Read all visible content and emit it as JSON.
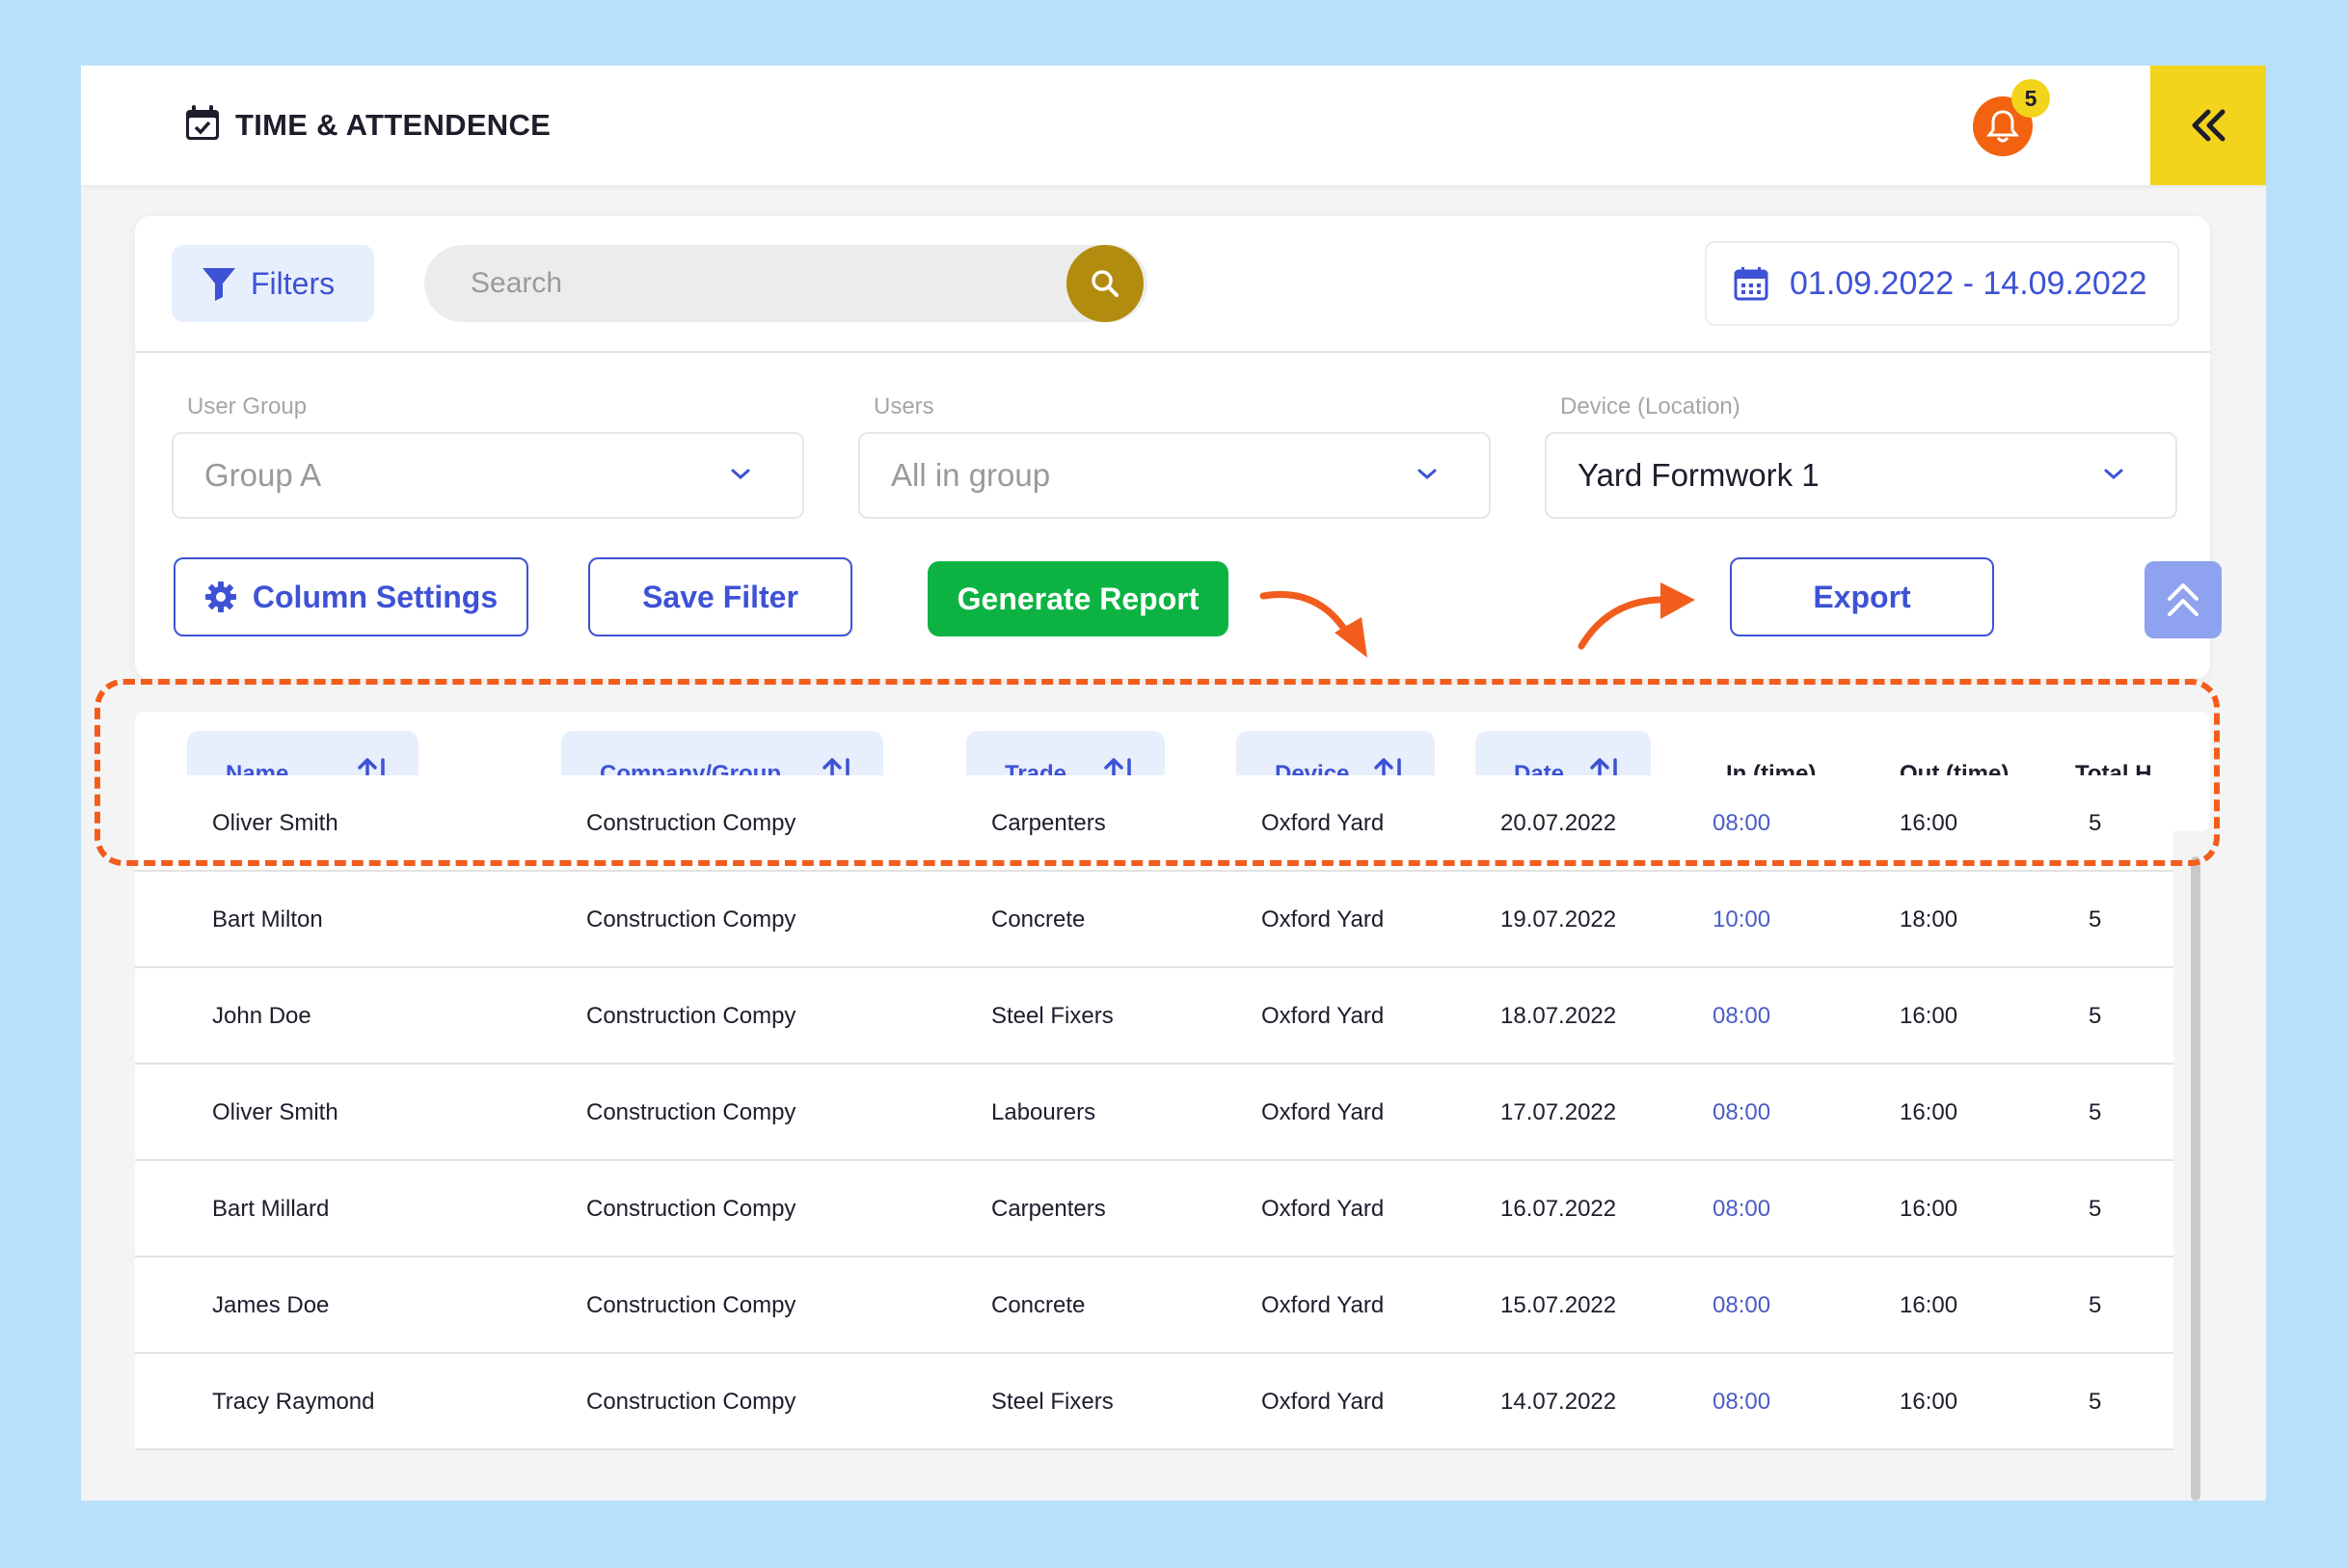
{
  "header": {
    "title": "TIME & ATTENDENCE",
    "notification_count": "5"
  },
  "toolbar": {
    "filters_label": "Filters",
    "search_placeholder": "Search",
    "date_range": "01.09.2022 - 14.09.2022"
  },
  "filters": {
    "user_group": {
      "label": "User Group",
      "value": "Group A"
    },
    "users": {
      "label": "Users",
      "value": "All in group"
    },
    "device": {
      "label": "Device (Location)",
      "value": "Yard Formwork 1"
    }
  },
  "actions": {
    "column_settings": "Column Settings",
    "save_filter": "Save Filter",
    "generate_report": "Generate Report",
    "export": "Export"
  },
  "table": {
    "columns": [
      "Name",
      "Company/Group",
      "Trade",
      "Device",
      "Date",
      "In (time)",
      "Out (time)",
      "Total H"
    ],
    "rows": [
      [
        "Oliver Smith",
        "Construction Compy",
        "Carpenters",
        "Oxford Yard",
        "20.07.2022",
        "08:00",
        "16:00",
        "5"
      ],
      [
        "Bart Milton",
        "Construction Compy",
        "Concrete",
        "Oxford Yard",
        "19.07.2022",
        "10:00",
        "18:00",
        "5"
      ],
      [
        "John Doe",
        "Construction Compy",
        "Steel Fixers",
        "Oxford Yard",
        "18.07.2022",
        "08:00",
        "16:00",
        "5"
      ],
      [
        "Oliver Smith",
        "Construction Compy",
        "Labourers",
        "Oxford Yard",
        "17.07.2022",
        "08:00",
        "16:00",
        "5"
      ],
      [
        "Bart Millard",
        "Construction Compy",
        "Carpenters",
        "Oxford Yard",
        "16.07.2022",
        "08:00",
        "16:00",
        "5"
      ],
      [
        "James Doe",
        "Construction Compy",
        "Concrete",
        "Oxford Yard",
        "15.07.2022",
        "08:00",
        "16:00",
        "5"
      ],
      [
        "Tracy Raymond",
        "Construction Compy",
        "Steel Fixers",
        "Oxford Yard",
        "14.07.2022",
        "08:00",
        "16:00",
        "5"
      ]
    ]
  },
  "colors": {
    "accent": "#3d52d5",
    "highlight": "#f25d1d",
    "yellow": "#f3d41c",
    "green": "#0cb342"
  }
}
